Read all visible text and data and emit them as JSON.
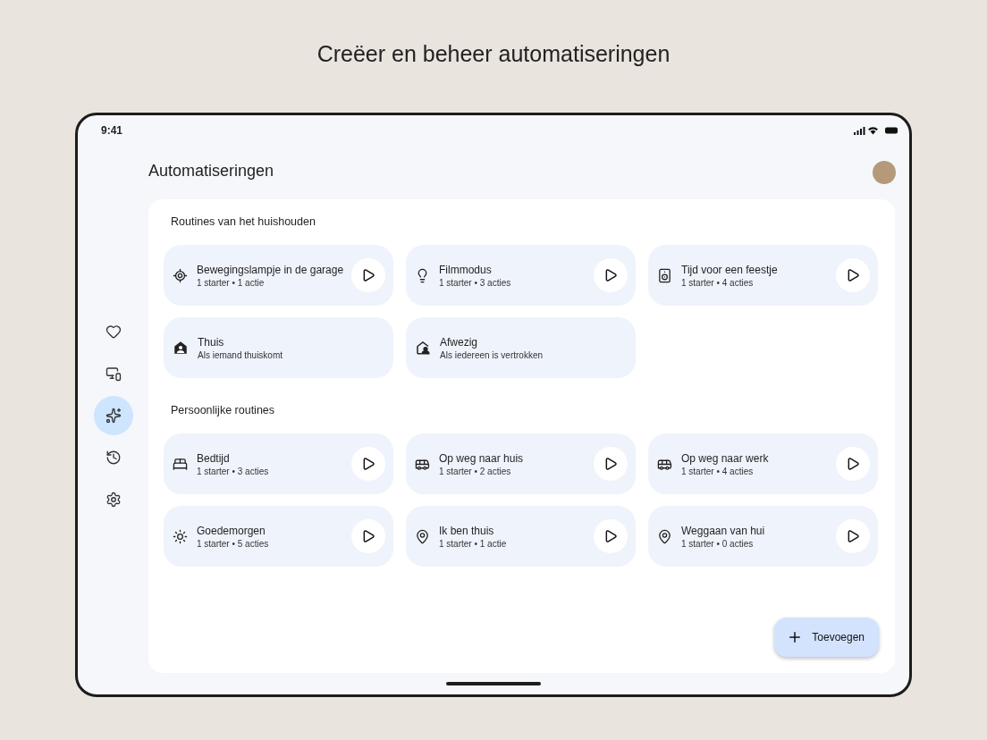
{
  "headline": "Creëer en beheer automatiseringen",
  "status_bar": {
    "time": "9:41"
  },
  "nav": [
    {
      "kind": "favorites",
      "selected": false
    },
    {
      "kind": "devices",
      "selected": false
    },
    {
      "kind": "automations",
      "selected": true
    },
    {
      "kind": "history",
      "selected": false
    },
    {
      "kind": "settings",
      "selected": false
    }
  ],
  "title": "Automatiseringen",
  "sections": [
    {
      "heading": "Routines van het huishouden",
      "cards": [
        {
          "kind": "motion",
          "title": "Bewegingslampje in de garage",
          "subtitle": "1 starter • 1 actie",
          "playable": true
        },
        {
          "kind": "bulb",
          "title": "Filmmodus",
          "subtitle": "1 starter • 3 acties",
          "playable": true
        },
        {
          "kind": "speaker",
          "title": "Tijd voor een feestje",
          "subtitle": "1 starter • 4 acties",
          "playable": true
        },
        {
          "kind": "home",
          "title": "Thuis",
          "subtitle": "Als iemand thuiskomt",
          "playable": false
        },
        {
          "kind": "away",
          "title": "Afwezig",
          "subtitle": "Als iedereen is vertrokken",
          "playable": false
        }
      ]
    },
    {
      "heading": "Persoonlijke routines",
      "cards": [
        {
          "kind": "bed",
          "title": "Bedtijd",
          "subtitle": "1 starter • 3 acties",
          "playable": true
        },
        {
          "kind": "commute",
          "title": "Op weg naar huis",
          "subtitle": "1 starter • 2 acties",
          "playable": true
        },
        {
          "kind": "commute",
          "title": "Op weg naar werk",
          "subtitle": "1 starter • 4 acties",
          "playable": true
        },
        {
          "kind": "sun",
          "title": "Goedemorgen",
          "subtitle": "1 starter • 5 acties",
          "playable": true
        },
        {
          "kind": "pin",
          "title": "Ik ben thuis",
          "subtitle": "1 starter • 1 actie",
          "playable": true
        },
        {
          "kind": "pin",
          "title": "Weggaan van hui",
          "subtitle": "1 starter • 0 acties",
          "playable": true
        }
      ]
    }
  ],
  "fab": {
    "label": "Toevoegen"
  }
}
